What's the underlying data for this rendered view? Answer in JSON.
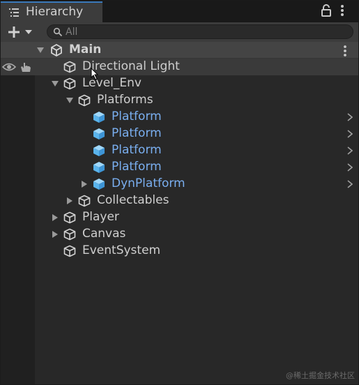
{
  "window": {
    "tab_title": "Hierarchy",
    "icons": {
      "tab": "list-icon",
      "lock": "lock-icon",
      "menu": "kebab-menu-icon"
    }
  },
  "toolbar": {
    "create_button": "plus-dropdown",
    "search": {
      "placeholder": "All",
      "value": ""
    }
  },
  "scene": {
    "name": "Main",
    "icon": "unity-logo-icon"
  },
  "hierarchy": [
    {
      "label": "Directional Light",
      "type": "gameobject",
      "depth": 0,
      "arrow": "none",
      "hovered": true
    },
    {
      "label": "Level_Env",
      "type": "gameobject",
      "depth": 0,
      "arrow": "expanded"
    },
    {
      "label": "Platforms",
      "type": "gameobject",
      "depth": 1,
      "arrow": "expanded"
    },
    {
      "label": "Platform",
      "type": "prefab",
      "depth": 2,
      "arrow": "none",
      "has_chevron": true
    },
    {
      "label": "Platform",
      "type": "prefab",
      "depth": 2,
      "arrow": "none",
      "has_chevron": true
    },
    {
      "label": "Platform",
      "type": "prefab",
      "depth": 2,
      "arrow": "none",
      "has_chevron": true
    },
    {
      "label": "Platform",
      "type": "prefab",
      "depth": 2,
      "arrow": "none",
      "has_chevron": true
    },
    {
      "label": "DynPlatform",
      "type": "prefab",
      "depth": 2,
      "arrow": "collapsed",
      "has_chevron": true
    },
    {
      "label": "Collectables",
      "type": "gameobject",
      "depth": 1,
      "arrow": "collapsed"
    },
    {
      "label": "Player",
      "type": "gameobject",
      "depth": 0,
      "arrow": "collapsed"
    },
    {
      "label": "Canvas",
      "type": "gameobject",
      "depth": 0,
      "arrow": "collapsed"
    },
    {
      "label": "EventSystem",
      "type": "gameobject",
      "depth": 0,
      "arrow": "none"
    }
  ],
  "gutter_icons": [
    "eye-icon",
    "hand-icon"
  ],
  "colors": {
    "prefab_text": "#7aaff0",
    "prefab_cube": "#6ec0f0",
    "tab_accent": "#3a79bb",
    "background": "#282828"
  },
  "watermark": "@稀土掘金技术社区"
}
